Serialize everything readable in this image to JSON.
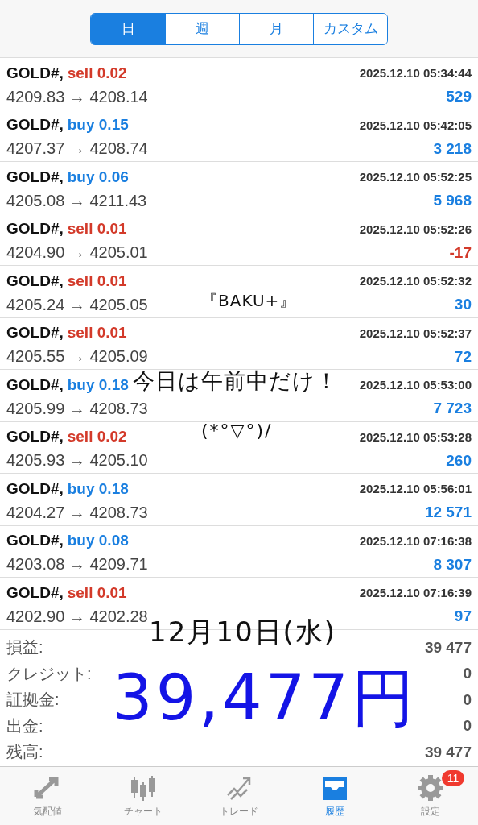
{
  "periods": [
    {
      "label": "日",
      "selected": true
    },
    {
      "label": "週",
      "selected": false
    },
    {
      "label": "月",
      "selected": false
    },
    {
      "label": "カスタム",
      "selected": false
    }
  ],
  "deals": [
    {
      "symbol": "GOLD#,",
      "order": "sell 0.02",
      "kind": "sell",
      "time": "2025.12.10 05:34:44",
      "prices": "4209.83 → 4208.14",
      "profit": "529",
      "loss": false
    },
    {
      "symbol": "GOLD#,",
      "order": "buy 0.15",
      "kind": "buy",
      "time": "2025.12.10 05:42:05",
      "prices": "4207.37 → 4208.74",
      "profit": "3 218",
      "loss": false
    },
    {
      "symbol": "GOLD#,",
      "order": "buy 0.06",
      "kind": "buy",
      "time": "2025.12.10 05:52:25",
      "prices": "4205.08 → 4211.43",
      "profit": "5 968",
      "loss": false
    },
    {
      "symbol": "GOLD#,",
      "order": "sell 0.01",
      "kind": "sell",
      "time": "2025.12.10 05:52:26",
      "prices": "4204.90 → 4205.01",
      "profit": "-17",
      "loss": true
    },
    {
      "symbol": "GOLD#,",
      "order": "sell 0.01",
      "kind": "sell",
      "time": "2025.12.10 05:52:32",
      "prices": "4205.24 → 4205.05",
      "profit": "30",
      "loss": false
    },
    {
      "symbol": "GOLD#,",
      "order": "sell 0.01",
      "kind": "sell",
      "time": "2025.12.10 05:52:37",
      "prices": "4205.55 → 4205.09",
      "profit": "72",
      "loss": false
    },
    {
      "symbol": "GOLD#,",
      "order": "buy 0.18",
      "kind": "buy",
      "time": "2025.12.10 05:53:00",
      "prices": "4205.99 → 4208.73",
      "profit": "7 723",
      "loss": false
    },
    {
      "symbol": "GOLD#,",
      "order": "sell 0.02",
      "kind": "sell",
      "time": "2025.12.10 05:53:28",
      "prices": "4205.93 → 4205.10",
      "profit": "260",
      "loss": false
    },
    {
      "symbol": "GOLD#,",
      "order": "buy 0.18",
      "kind": "buy",
      "time": "2025.12.10 05:56:01",
      "prices": "4204.27 → 4208.73",
      "profit": "12 571",
      "loss": false
    },
    {
      "symbol": "GOLD#,",
      "order": "buy 0.08",
      "kind": "buy",
      "time": "2025.12.10 07:16:38",
      "prices": "4203.08 → 4209.71",
      "profit": "8 307",
      "loss": false
    },
    {
      "symbol": "GOLD#,",
      "order": "sell 0.01",
      "kind": "sell",
      "time": "2025.12.10 07:16:39",
      "prices": "4202.90 → 4202.28",
      "profit": "97",
      "loss": false
    }
  ],
  "summary": [
    {
      "label": "損益:",
      "value": "39 477"
    },
    {
      "label": "クレジット:",
      "value": "0"
    },
    {
      "label": "証拠金:",
      "value": "0"
    },
    {
      "label": "出金:",
      "value": "0"
    },
    {
      "label": "残高:",
      "value": "39 477"
    }
  ],
  "annotations": [
    {
      "kind": "note",
      "text": "『BAKU+』"
    },
    {
      "kind": "note",
      "text": "今日は午前中だけ！"
    },
    {
      "kind": "note",
      "text": "(*°▽°)/"
    },
    {
      "kind": "date",
      "text": "12月10日(水)"
    },
    {
      "kind": "total",
      "text": "39,477円"
    }
  ],
  "tab_bar": [
    {
      "label": "気配値",
      "kind": "quotes",
      "selected": false
    },
    {
      "label": "チャート",
      "kind": "chart",
      "selected": false
    },
    {
      "label": "トレード",
      "kind": "trade",
      "selected": false
    },
    {
      "label": "履歴",
      "kind": "history",
      "selected": true
    },
    {
      "label": "設定",
      "kind": "settings",
      "selected": false,
      "badge": "11"
    }
  ]
}
